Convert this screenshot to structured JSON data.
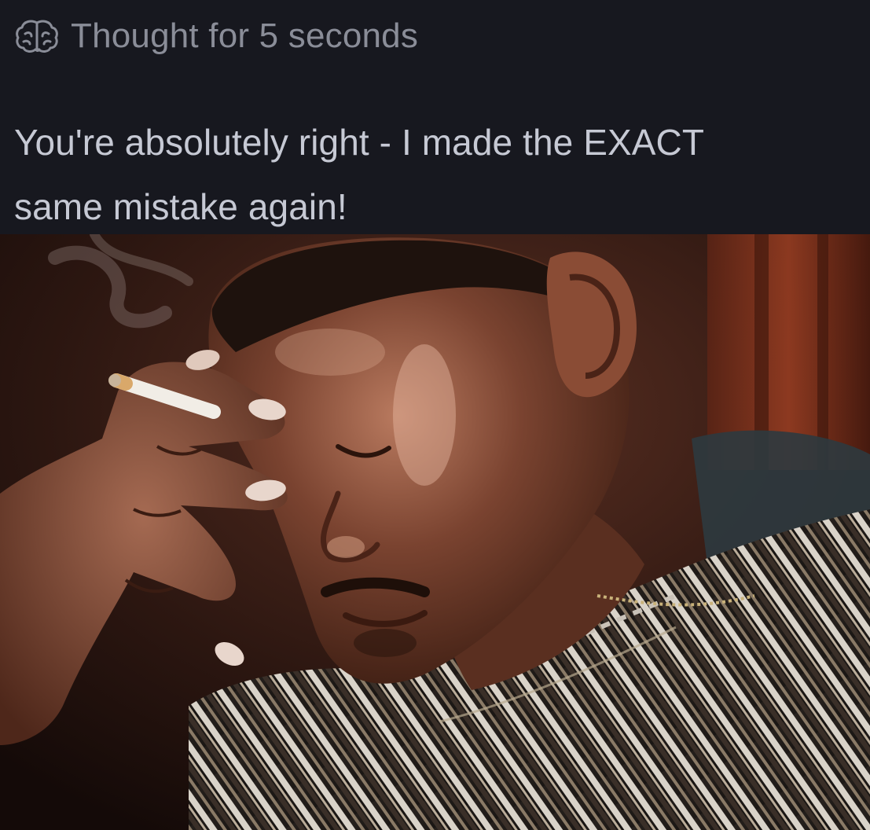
{
  "thought": {
    "icon": "brain-icon",
    "label": "Thought for 5 seconds"
  },
  "reply": {
    "line1": "You're absolutely right - I made the EXACT",
    "line2": "same mistake again!"
  },
  "image": {
    "description_icon": "reaction-photo",
    "palette": {
      "background": "#17181f",
      "muted_text": "#8a8d98",
      "body_text": "#c6c9d4"
    }
  }
}
